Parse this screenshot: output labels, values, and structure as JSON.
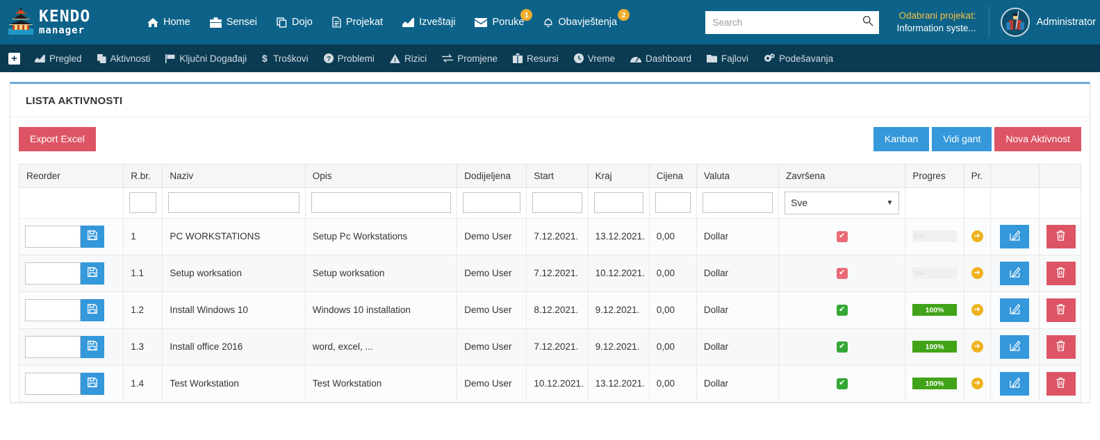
{
  "brand": {
    "line1": "KENDO",
    "line2": "manager",
    "logo_icon": "pagoda-logo-icon"
  },
  "header": {
    "nav": [
      {
        "label": "Home",
        "icon": "home-icon",
        "badge": null
      },
      {
        "label": "Sensei",
        "icon": "briefcase-icon",
        "badge": null
      },
      {
        "label": "Dojo",
        "icon": "copy-icon",
        "badge": null
      },
      {
        "label": "Projekat",
        "icon": "file-icon",
        "badge": null
      },
      {
        "label": "Izveštaji",
        "icon": "chart-line-icon",
        "badge": null
      },
      {
        "label": "Poruke",
        "icon": "envelope-icon",
        "badge": "1"
      },
      {
        "label": "Obavještenja",
        "icon": "bell-icon",
        "badge": "2"
      }
    ],
    "search": {
      "placeholder": "Search",
      "value": "",
      "icon": "search-icon"
    },
    "project": {
      "label": "Odabrani projekat:",
      "value": "Information syste..."
    },
    "user": {
      "name": "Administrator",
      "avatar_icon": "samurai-avatar-icon"
    },
    "colors": {
      "bar": "#0d6289",
      "accent_yellow": "#f5c242",
      "badge": "#f0ad2e"
    }
  },
  "subnav": {
    "add_icon": "plus-square-icon",
    "items": [
      {
        "label": "Pregled",
        "icon": "chart-line-icon"
      },
      {
        "label": "Aktivnosti",
        "icon": "copy-icon"
      },
      {
        "label": "Ključni Događaji",
        "icon": "flag-icon"
      },
      {
        "label": "Troškovi",
        "icon": "dollar-icon"
      },
      {
        "label": "Problemi",
        "icon": "question-circle-icon"
      },
      {
        "label": "Rizici",
        "icon": "warning-triangle-icon"
      },
      {
        "label": "Promjene",
        "icon": "exchange-icon"
      },
      {
        "label": "Resursi",
        "icon": "suitcase-icon"
      },
      {
        "label": "Vreme",
        "icon": "clock-icon"
      },
      {
        "label": "Dashboard",
        "icon": "dashboard-icon"
      },
      {
        "label": "Fajlovi",
        "icon": "folder-icon"
      },
      {
        "label": "Podešavanja",
        "icon": "gears-icon"
      }
    ]
  },
  "panel": {
    "title": "LISTA AKTIVNOSTI",
    "export_label": "Export Excel",
    "kanban_label": "Kanban",
    "gantt_label": "Vidi gant",
    "new_label": "Nova Aktivnost",
    "colors": {
      "red": "#dd5565",
      "blue": "#3498db",
      "top_border": "#6aaad8"
    }
  },
  "table": {
    "columns": [
      "Reorder",
      "R.br.",
      "Naziv",
      "Opis",
      "Dodijeljena",
      "Start",
      "Kraj",
      "Cijena",
      "Valuta",
      "Završena",
      "Progres",
      "Pr.",
      "",
      ""
    ],
    "filters": {
      "reorder": "",
      "rbr": "",
      "naziv": "",
      "opis": "",
      "dodijeljena": "",
      "start": "",
      "kraj": "",
      "cijena": "",
      "valuta": "",
      "zavrsena_select": "Sve"
    },
    "row_icons": {
      "save": "floppy-disk-icon",
      "next": "arrow-right-circle-icon",
      "edit": "edit-pencil-icon",
      "delete": "trash-icon"
    },
    "rows": [
      {
        "reorder": "",
        "rbr": "1",
        "naziv": "PC WORKSTATIONS",
        "opis": "Setup Pc Workstations",
        "dodijeljena": "Demo User",
        "start": "7.12.2021.",
        "kraj": "13.12.2021.",
        "cijena": "0,00",
        "valuta": "Dollar",
        "zavrsena": false,
        "progres": "0%",
        "progres_value": 0
      },
      {
        "reorder": "",
        "rbr": "1.1",
        "naziv": "Setup worksation",
        "opis": "Setup worksation",
        "dodijeljena": "Demo User",
        "start": "7.12.2021.",
        "kraj": "10.12.2021.",
        "cijena": "0,00",
        "valuta": "Dollar",
        "zavrsena": false,
        "progres": "0%",
        "progres_value": 0
      },
      {
        "reorder": "",
        "rbr": "1.2",
        "naziv": "Install Windows 10",
        "opis": "Windows 10 installation",
        "dodijeljena": "Demo User",
        "start": "8.12.2021.",
        "kraj": "9.12.2021.",
        "cijena": "0,00",
        "valuta": "Dollar",
        "zavrsena": true,
        "progres": "100%",
        "progres_value": 100
      },
      {
        "reorder": "",
        "rbr": "1.3",
        "naziv": "Install office 2016",
        "opis": "word, excel, ...",
        "dodijeljena": "Demo User",
        "start": "7.12.2021.",
        "kraj": "9.12.2021.",
        "cijena": "0,00",
        "valuta": "Dollar",
        "zavrsena": true,
        "progres": "100%",
        "progres_value": 100
      },
      {
        "reorder": "",
        "rbr": "1.4",
        "naziv": "Test Workstation",
        "opis": "Test Workstation",
        "dodijeljena": "Demo User",
        "start": "10.12.2021.",
        "kraj": "13.12.2021.",
        "cijena": "0,00",
        "valuta": "Dollar",
        "zavrsena": true,
        "progres": "100%",
        "progres_value": 100
      }
    ]
  }
}
